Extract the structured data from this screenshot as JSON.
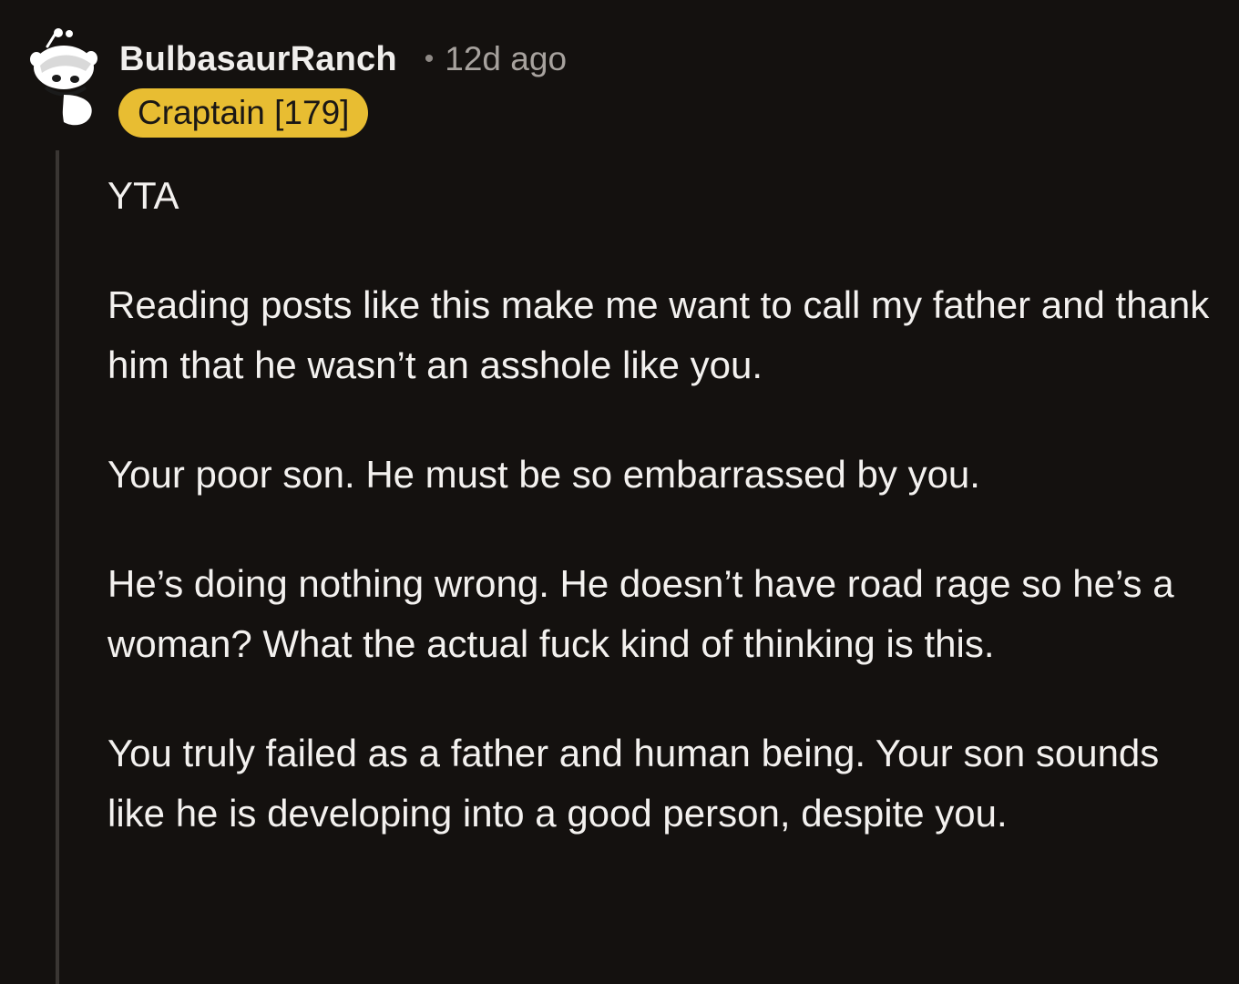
{
  "comment": {
    "username": "BulbasaurRanch",
    "separator": "•",
    "timestamp": "12d ago",
    "flair": "Craptain [179]",
    "avatar_icon": "reddit-snoo-icon",
    "paragraphs": [
      "YTA",
      "Reading posts like this make me want to call my father and thank him that he wasn’t an asshole like you.",
      "Your poor son. He must be so embarrassed by you.",
      "He’s doing nothing wrong. He doesn’t have road rage so he’s a woman? What the actual fuck kind of thinking is this.",
      "You truly failed as a father and human being. Your son sounds like he is developing into a good person, despite you."
    ]
  },
  "colors": {
    "background": "#14110f",
    "flair_background": "#e8bd32",
    "text": "#f3f1ef",
    "muted_text": "#a7a29e",
    "thread_line": "#3a3633"
  }
}
